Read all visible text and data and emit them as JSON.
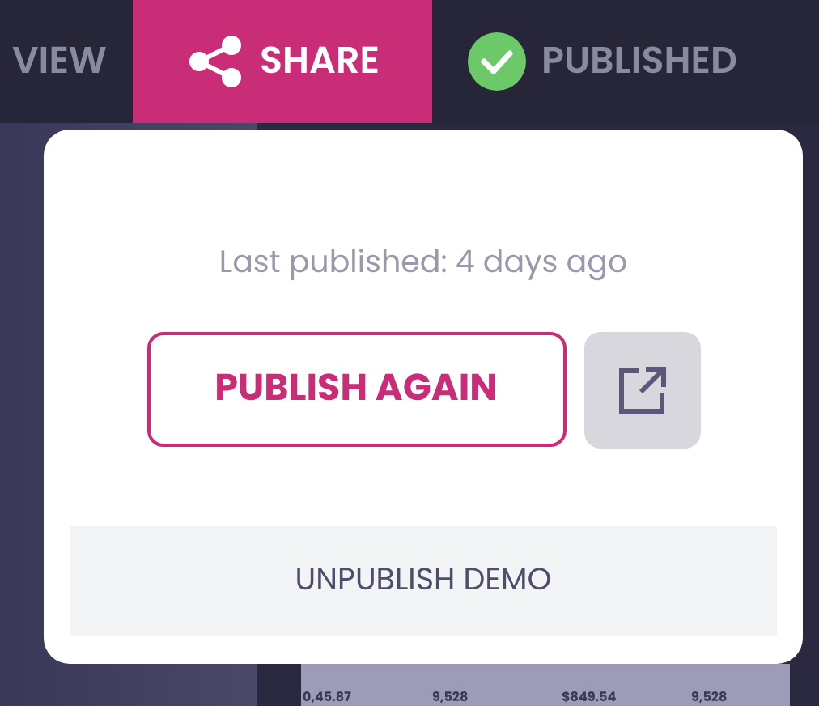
{
  "tabs": [
    {
      "label": "VIEW",
      "kind": "plain",
      "selected": false
    },
    {
      "label": "SHARE",
      "kind": "share",
      "selected": true
    },
    {
      "label": "PUBLISHED",
      "kind": "status",
      "selected": false
    }
  ],
  "popover": {
    "status": "Last published: 4 days ago",
    "primary_button": "PUBLISH AGAIN",
    "secondary_button": "UNPUBLISH DEMO"
  },
  "preview_values": [
    "0,45.87",
    "9,528",
    "$849.54",
    "9,528"
  ]
}
